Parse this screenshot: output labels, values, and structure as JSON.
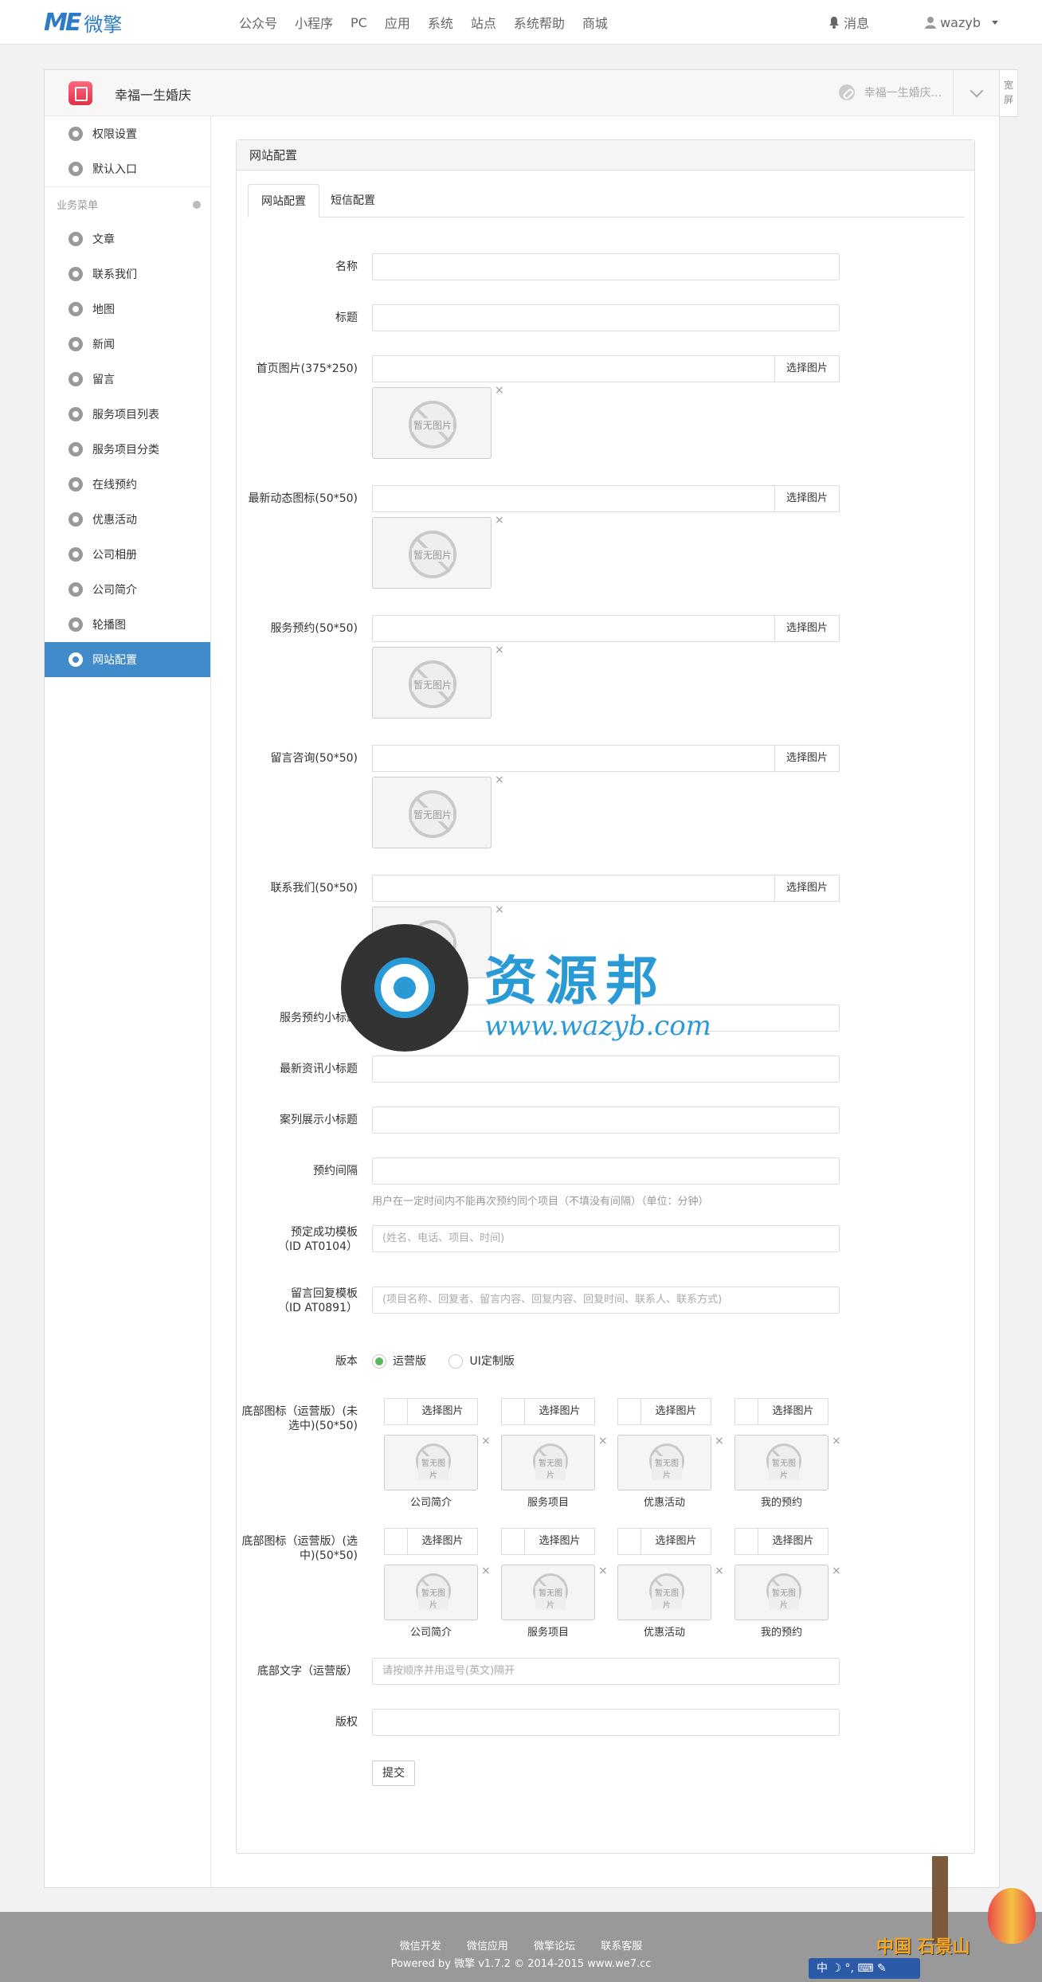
{
  "topbar": {
    "logo_mark": "ME",
    "logo_text": "微擎",
    "nav": [
      "公众号",
      "小程序",
      "PC",
      "应用",
      "系统",
      "站点",
      "系统帮助",
      "商城"
    ],
    "messages": "消息",
    "user": "wazyb"
  },
  "app": {
    "name": "幸福一生婚庆",
    "switch_label": "幸福一生婚庆...",
    "wide_label": "宽屏"
  },
  "sidebar": {
    "top_items": [
      "权限设置",
      "默认入口"
    ],
    "group_label": "业务菜单",
    "items": [
      "文章",
      "联系我们",
      "地图",
      "新闻",
      "留言",
      "服务项目列表",
      "服务项目分类",
      "在线预约",
      "优惠活动",
      "公司相册",
      "公司简介",
      "轮播图",
      "网站配置"
    ],
    "active": "网站配置"
  },
  "panel": {
    "title": "网站配置",
    "tabs": [
      "网站配置",
      "短信配置"
    ]
  },
  "form": {
    "name_label": "名称",
    "title_label": "标题",
    "home_img_label": "首页图片(375*250)",
    "news_icon_label": "最新动态图标(50*50)",
    "service_booking_label": "服务预约(50*50)",
    "message_consult_label": "留言咨询(50*50)",
    "contact_label": "联系我们(50*50)",
    "pick_image": "选择图片",
    "no_image": "暂无图片",
    "close": "×",
    "service_sub_label": "服务预约小标题",
    "news_sub_label": "最新资讯小标题",
    "case_sub_label": "案列展示小标题",
    "interval_label": "预约间隔",
    "interval_hint": "用户在一定时间内不能再次预约同个项目（不填没有间隔）（单位：分钟）",
    "success_tpl_label_1": "预定成功模板",
    "success_tpl_label_2": "（ID AT0104）",
    "success_tpl_placeholder": "(姓名、电话、项目、时间)",
    "reply_tpl_label_1": "留言回复模板",
    "reply_tpl_label_2": "（ID AT0891）",
    "reply_tpl_placeholder": "(项目名称、回复者、留言内容、回复内容、回复时间、联系人、联系方式)",
    "version_label": "版本",
    "version_options": [
      "运营版",
      "UI定制版"
    ],
    "version_selected": "运营版",
    "bottom_icon_off_label_1": "底部图标（运营版）(未",
    "bottom_icon_off_label_2": "选中)(50*50)",
    "bottom_icon_on_label_1": "底部图标（运营版）(选",
    "bottom_icon_on_label_2": "中)(50*50)",
    "bottom_captions": [
      "公司简介",
      "服务项目",
      "优惠活动",
      "我的预约"
    ],
    "bottom_text_label": "底部文字（运营版）",
    "bottom_text_placeholder": "请按顺序并用逗号(英文)隔开",
    "copyright_label": "版权",
    "submit": "提交"
  },
  "watermark": {
    "title": "资源邦",
    "url": "www.wazyb.com"
  },
  "footer": {
    "links": [
      "微信开发",
      "微信应用",
      "微擎论坛",
      "联系客服"
    ],
    "copyright": "Powered by 微擎 v1.7.2 © 2014-2015 www.we7.cc"
  },
  "overlay": {
    "ime": "中 ☽ °, ⌨ ✎",
    "sign": "中国 石景山"
  },
  "colors": {
    "brand": "#2d7bc6",
    "active_menu": "#428bca",
    "radio_on": "#5cb85c"
  }
}
